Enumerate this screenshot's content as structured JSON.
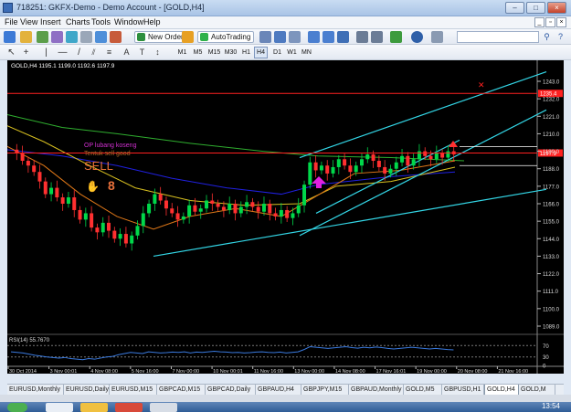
{
  "window": {
    "title": "718251: GKFX-Demo - Demo Account - [GOLD,H4]",
    "controls": [
      "–",
      "□",
      "×"
    ]
  },
  "menu": [
    "File",
    "View",
    "Insert",
    "Charts",
    "Tools",
    "Window",
    "Help"
  ],
  "mdi_controls": [
    "_",
    "▫",
    "×"
  ],
  "toolbar": {
    "new_order_label": "New Order",
    "autotrading_label": "AutoTrading",
    "search_placeholder": ""
  },
  "timeframes": [
    "M1",
    "M5",
    "M15",
    "M30",
    "H1",
    "H4",
    "D1",
    "W1",
    "MN"
  ],
  "active_timeframe": "H4",
  "chart": {
    "header": "GOLD,H4  1195.1 1199.0 1192.6 1197.9",
    "signal_lines": [
      "OP lubang koseng",
      "Tentuk sell good"
    ],
    "signal_big": "SELL",
    "signal_glyph": "8",
    "price_ticks": [
      "1243.0",
      "1232.0",
      "1221.0",
      "1210.0",
      "1199.0",
      "1188.0",
      "1177.0",
      "1166.0",
      "1155.0",
      "1144.0",
      "1133.0",
      "1122.0",
      "1111.0",
      "1100.0",
      "1089.0"
    ],
    "price_min": 1089.0,
    "price_max": 1243.0,
    "red_line_top_label": "1235.4",
    "red_line_top_value": 1235.4,
    "current_price_label": "1197.9",
    "current_price_value": 1197.9,
    "rsi_label": "RSI(14) 55.7670",
    "rsi_ticks": [
      "70",
      "30",
      "0"
    ],
    "time_ticks": [
      "30 Oct 2014",
      "3 Nov 00:01",
      "4 Nov 08:00",
      "5 Nov 16:00",
      "7 Nov 00:00",
      "10 Nov 00:01",
      "11 Nov 16:00",
      "13 Nov 00:00",
      "14 Nov 08:00",
      "17 Nov 16:01",
      "19 Nov 00:00",
      "20 Nov 08:00",
      "21 Nov 16:00"
    ],
    "colors": {
      "background": "#000000",
      "candle_up": "#00d84a",
      "candle_down": "#ff3030",
      "channel": "#33d6e6",
      "ma_green": "#2fae2f",
      "ma_blue": "#2020e0",
      "ma_yellow": "#d8c020",
      "ma_orange": "#e07818",
      "hline_red": "#ff2020",
      "signal_magenta": "#d030d0",
      "signal_orange": "#e8703a"
    }
  },
  "tabs": [
    "EURUSD,Monthly",
    "EURUSD,Daily",
    "EURUSD,M15",
    "GBPCAD,M15",
    "GBPCAD,Daily",
    "GBPAUD,H4",
    "GBPJPY,M15",
    "GBPAUD,Monthly",
    "GOLD,M5",
    "GBPUSD,H1",
    "GOLD,H4",
    "GOLD,M"
  ],
  "active_tab": "GOLD,H4",
  "taskbar": {
    "clock": "13:54"
  }
}
